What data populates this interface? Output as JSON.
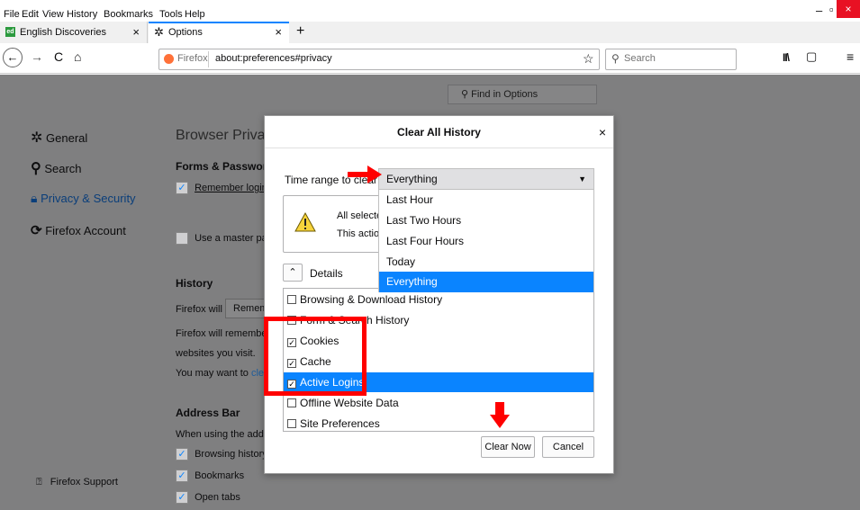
{
  "menubar": {
    "items": [
      "File",
      "Edit",
      "View",
      "History",
      "Bookmarks",
      "Tools",
      "Help"
    ]
  },
  "window_controls": {
    "minimize": "–",
    "restore": "▫",
    "close": "×"
  },
  "tabs": [
    {
      "favicon": "ed",
      "label": "English Discoveries",
      "close": "×"
    },
    {
      "favicon": "gear-icon",
      "label": "Options",
      "close": "×"
    }
  ],
  "new_tab": "+",
  "navbar": {
    "back": "←",
    "forward": "→",
    "reload": "C",
    "home": "⌂",
    "identity": "Firefox",
    "url": "about:preferences#privacy",
    "bookmark_star": "☆",
    "search_placeholder": "Search",
    "library": "II\\",
    "sidebar": "▢",
    "menu": "≡"
  },
  "find_in_options": "Find in Options",
  "sidebar": [
    {
      "icon": "gear-icon",
      "label": "General"
    },
    {
      "icon": "search-icon",
      "label": "Search"
    },
    {
      "icon": "lock-icon",
      "label": "Privacy & Security"
    },
    {
      "icon": "sync-icon",
      "label": "Firefox Account"
    }
  ],
  "support_link": "Firefox Support",
  "prefs": {
    "page_title": "Browser Privacy",
    "forms_heading": "Forms & Password",
    "remember_logins": "Remember login",
    "master_password": "Use a master pas",
    "history_heading": "History",
    "firefox_will": "Firefox will",
    "remember": "Remem",
    "will_remember": "Firefox will remembe",
    "websites": "websites you visit.",
    "may_want": "You may want to",
    "clear_link": "cle",
    "address_heading": "Address Bar",
    "using_address": "When using the addre",
    "browsing_history": "Browsing history",
    "bookmarks": "Bookmarks",
    "open_tabs": "Open tabs"
  },
  "dialog": {
    "title": "Clear All History",
    "close": "×",
    "time_range_label": "Time range to clear:",
    "warning_line1": "All selecte",
    "warning_line2": "This action",
    "details_label": "Details",
    "items": [
      {
        "label": "Browsing & Download History",
        "checked": false,
        "selected": false
      },
      {
        "label": "Form & Search History",
        "checked": false,
        "selected": false
      },
      {
        "label": "Cookies",
        "checked": true,
        "selected": false
      },
      {
        "label": "Cache",
        "checked": true,
        "selected": false
      },
      {
        "label": "Active Logins",
        "checked": true,
        "selected": true
      },
      {
        "label": "Offline Website Data",
        "checked": false,
        "selected": false
      },
      {
        "label": "Site Preferences",
        "checked": false,
        "selected": false
      }
    ],
    "clear_now": "Clear Now",
    "cancel": "Cancel"
  },
  "dropdown": {
    "selected": "Everything",
    "options": [
      "Last Hour",
      "Last Two Hours",
      "Last Four Hours",
      "Today",
      "Everything"
    ],
    "highlighted_index": 4
  },
  "colors": {
    "accent": "#0a84ff",
    "annotation": "#ff0000",
    "overlay": "#7f7f80"
  }
}
